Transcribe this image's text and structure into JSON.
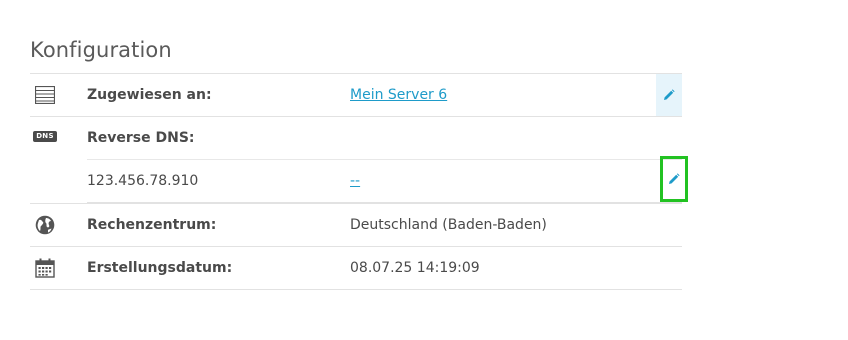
{
  "section": {
    "title": "Konfiguration"
  },
  "rows": {
    "assigned": {
      "icon": "server-list-icon",
      "label": "Zugewiesen an:",
      "value": "Mein Server 6",
      "edit_icon": "pencil-icon"
    },
    "reverse_dns": {
      "icon": "dns-badge-icon",
      "badge_text": "DNS",
      "label": "Reverse DNS:",
      "entry": {
        "ip": "123.456.78.910",
        "value": "--",
        "edit_icon": "pencil-icon"
      }
    },
    "datacenter": {
      "icon": "globe-icon",
      "label": "Rechenzentrum:",
      "value": "Deutschland (Baden-Baden)"
    },
    "created": {
      "icon": "calendar-icon",
      "label": "Erstellungsdatum:",
      "value": "08.07.25 14:19:09"
    }
  },
  "colors": {
    "link": "#1e9bc9",
    "edit_highlight": "#22c222",
    "edit_shaded_bg": "#e6f4fb"
  }
}
